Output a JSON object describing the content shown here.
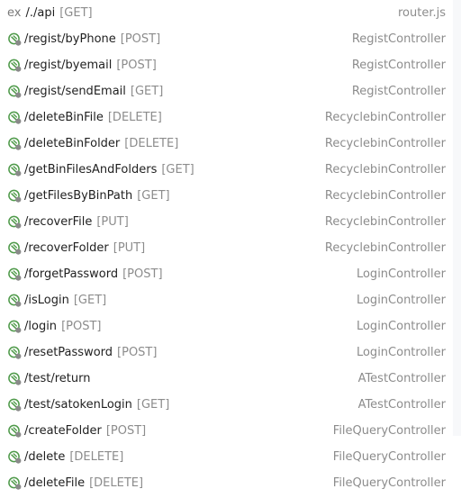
{
  "header": {
    "prefix": "ex",
    "path": "/./api",
    "method": "[GET]",
    "source": "router.js"
  },
  "endpoints": [
    {
      "path": "/regist/byPhone",
      "method": "[POST]",
      "controller": "RegistController",
      "icon": "endpoint-icon"
    },
    {
      "path": "/regist/byemail",
      "method": "[POST]",
      "controller": "RegistController",
      "icon": "endpoint-icon"
    },
    {
      "path": "/regist/sendEmail",
      "method": "[GET]",
      "controller": "RegistController",
      "icon": "endpoint-icon"
    },
    {
      "path": "/deleteBinFile",
      "method": "[DELETE]",
      "controller": "RecyclebinController",
      "icon": "endpoint-icon"
    },
    {
      "path": "/deleteBinFolder",
      "method": "[DELETE]",
      "controller": "RecyclebinController",
      "icon": "endpoint-icon"
    },
    {
      "path": "/getBinFilesAndFolders",
      "method": "[GET]",
      "controller": "RecyclebinController",
      "icon": "endpoint-icon"
    },
    {
      "path": "/getFilesByBinPath",
      "method": "[GET]",
      "controller": "RecyclebinController",
      "icon": "endpoint-icon"
    },
    {
      "path": "/recoverFile",
      "method": "[PUT]",
      "controller": "RecyclebinController",
      "icon": "endpoint-icon"
    },
    {
      "path": "/recoverFolder",
      "method": "[PUT]",
      "controller": "RecyclebinController",
      "icon": "endpoint-icon"
    },
    {
      "path": "/forgetPassword",
      "method": "[POST]",
      "controller": "LoginController",
      "icon": "endpoint-icon"
    },
    {
      "path": "/isLogin",
      "method": "[GET]",
      "controller": "LoginController",
      "icon": "endpoint-icon"
    },
    {
      "path": "/login",
      "method": "[POST]",
      "controller": "LoginController",
      "icon": "endpoint-icon"
    },
    {
      "path": "/resetPassword",
      "method": "[POST]",
      "controller": "LoginController",
      "icon": "endpoint-icon"
    },
    {
      "path": "/test/return",
      "method": "",
      "controller": "ATestController",
      "icon": "endpoint-icon"
    },
    {
      "path": "/test/satokenLogin",
      "method": "[GET]",
      "controller": "ATestController",
      "icon": "endpoint-icon"
    },
    {
      "path": "/createFolder",
      "method": "[POST]",
      "controller": "FileQueryController",
      "icon": "endpoint-icon"
    },
    {
      "path": "/delete",
      "method": "[DELETE]",
      "controller": "FileQueryController",
      "icon": "endpoint-icon"
    },
    {
      "path": "/deleteFile",
      "method": "[DELETE]",
      "controller": "FileQueryController",
      "icon": "endpoint-icon"
    }
  ],
  "colors": {
    "icon_green": "#4f9a4a",
    "icon_grey": "#8a8a8a",
    "muted_text": "#8c8c8c"
  }
}
